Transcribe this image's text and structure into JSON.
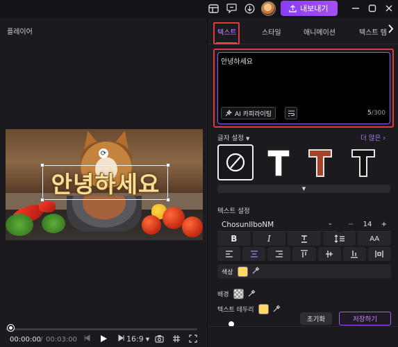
{
  "topbar": {
    "icons": [
      "layout-icon",
      "chat-icon",
      "download-icon"
    ],
    "export_label": "내보내기",
    "accent": "#9b45f5"
  },
  "player": {
    "title": "플레이어",
    "overlay_text": "안녕하세요",
    "current_time": "00:00:00",
    "separator": "/",
    "total_time": "00:03:00",
    "aspect_ratio": "16:9",
    "progress_fraction": 0
  },
  "panel": {
    "tabs": [
      "텍스트",
      "스타일",
      "애니메이션",
      "텍스트 템"
    ],
    "active_tab": "텍스트",
    "editor": {
      "text": "안녕하세요",
      "ai_label": "AI 카피라이팅",
      "count_current": "5",
      "count_max": "/300"
    },
    "char_settings_label": "글자 설정",
    "more_label": "더 많은",
    "text_settings_label": "텍스트 설정",
    "font_name": "ChosunIlboNM",
    "font_size": "14",
    "format_row1": [
      "B",
      "I",
      "T̲",
      "↕",
      "AA"
    ],
    "color_label": "색상",
    "color_value": "#ffd866",
    "background_label": "배경",
    "stroke_label": "텍스트 테두리",
    "stroke_color": "#ffd866",
    "reset_label": "초기화",
    "save_label": "저장하기",
    "partial_value": "0%"
  }
}
